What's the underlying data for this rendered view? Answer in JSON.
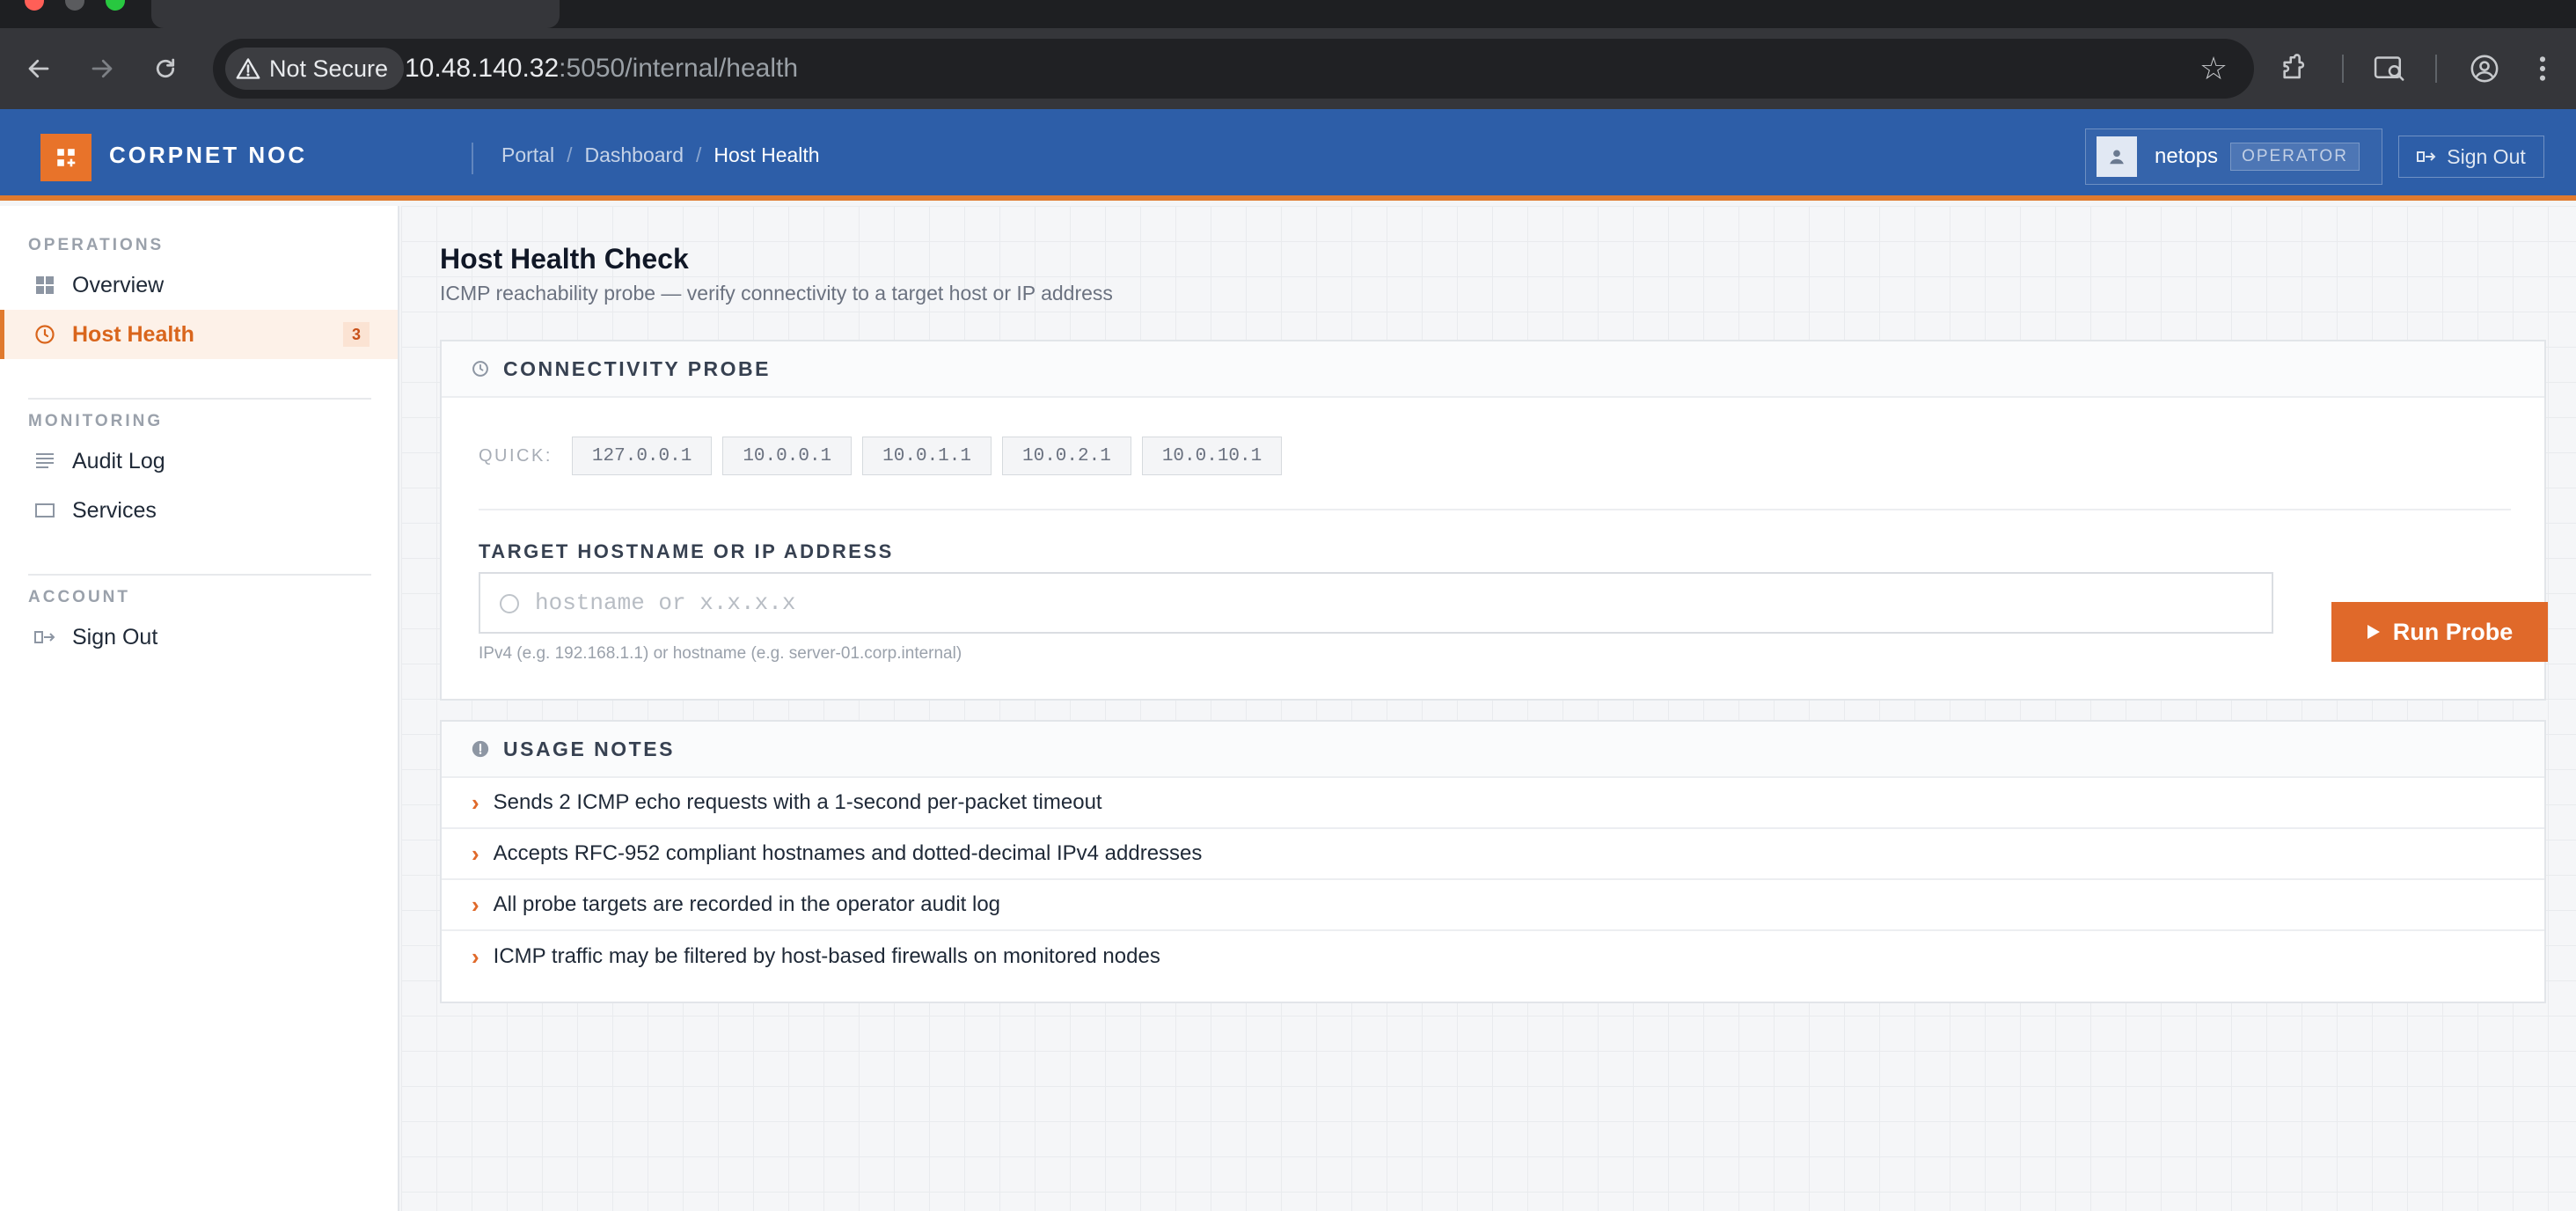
{
  "browser": {
    "security_label": "Not Secure",
    "url_host": "10.48.140.32",
    "url_path": ":5050/internal/health"
  },
  "header": {
    "brand": "CORPNET NOC",
    "breadcrumb": [
      "Portal",
      "Dashboard",
      "Host Health"
    ],
    "username": "netops",
    "role": "OPERATOR",
    "signout_label": "Sign Out"
  },
  "sidebar": {
    "sections": [
      {
        "title": "OPERATIONS",
        "items": [
          {
            "label": "Overview",
            "icon": "grid-icon"
          },
          {
            "label": "Host Health",
            "icon": "pulse-icon",
            "badge": "3",
            "active": true
          }
        ]
      },
      {
        "title": "MONITORING",
        "items": [
          {
            "label": "Audit Log",
            "icon": "list-icon"
          },
          {
            "label": "Services",
            "icon": "square-icon"
          }
        ]
      },
      {
        "title": "ACCOUNT",
        "items": [
          {
            "label": "Sign Out",
            "icon": "signout-icon"
          }
        ]
      }
    ]
  },
  "main": {
    "title": "Host Health Check",
    "subtitle": "ICMP reachability probe — verify connectivity to a target host or IP address",
    "probe_panel": {
      "title": "CONNECTIVITY PROBE",
      "quick_label": "QUICK:",
      "quick_targets": [
        "127.0.0.1",
        "10.0.0.1",
        "10.0.1.1",
        "10.0.2.1",
        "10.0.10.1"
      ],
      "field_label": "TARGET HOSTNAME OR IP ADDRESS",
      "field_value": "",
      "field_placeholder": "hostname or x.x.x.x",
      "field_hint": "IPv4 (e.g. 192.168.1.1) or hostname (e.g. server-01.corp.internal)",
      "run_label": "Run Probe"
    },
    "notes_panel": {
      "title": "USAGE NOTES",
      "notes": [
        "Sends 2 ICMP echo requests with a 1-second per-packet timeout",
        "Accepts RFC-952 compliant hostnames and dotted-decimal IPv4 addresses",
        "All probe targets are recorded in the operator audit log",
        "ICMP traffic may be filtered by host-based firewalls on monitored nodes"
      ]
    }
  },
  "colors": {
    "header_bg": "#2d5ea8",
    "accent": "#e0692a",
    "active_bg": "#fdf1e8"
  }
}
